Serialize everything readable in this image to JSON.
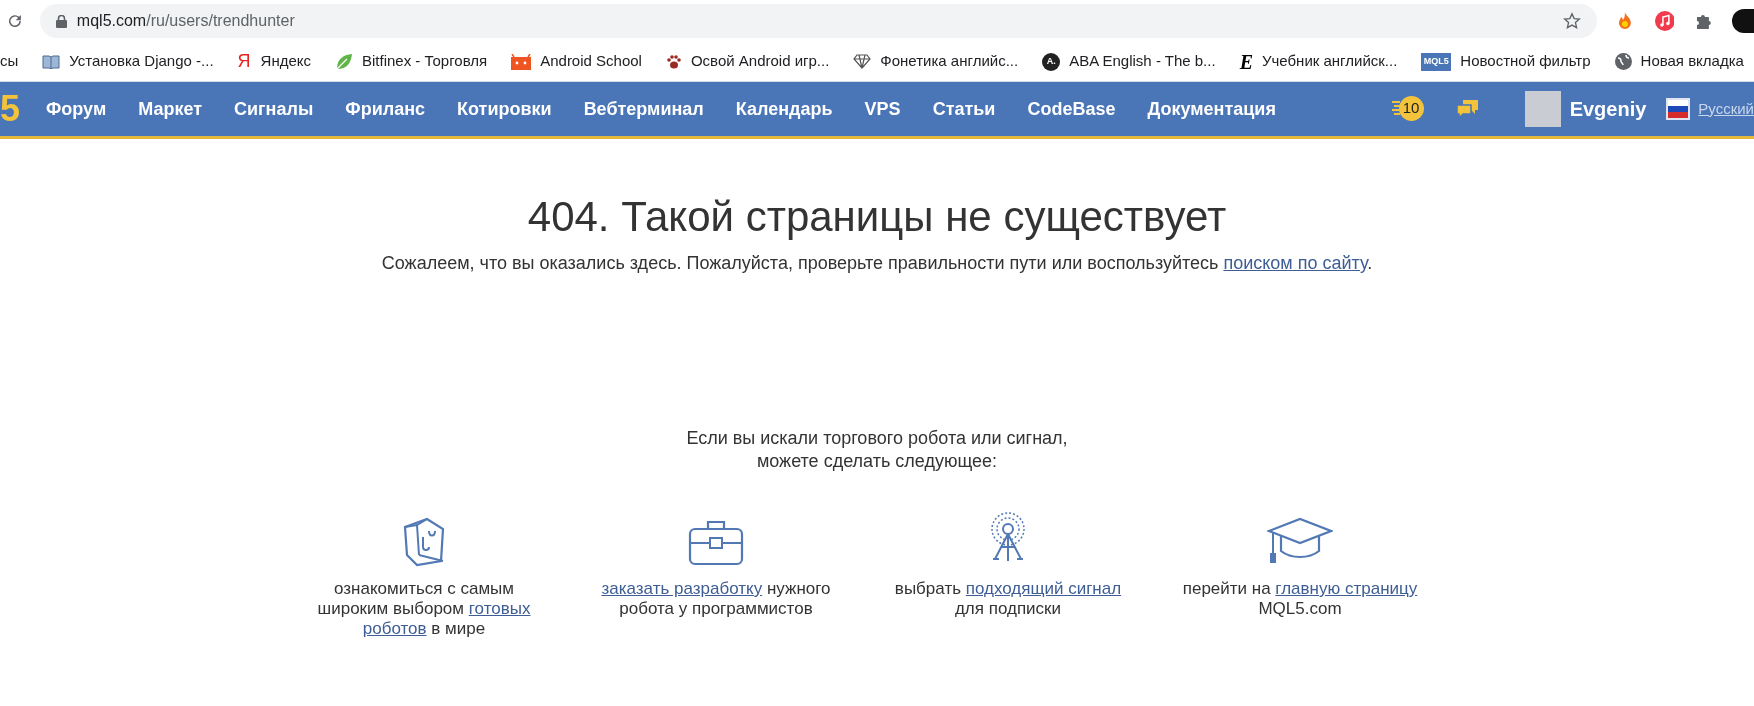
{
  "browser": {
    "url_host": "mql5.com",
    "url_path": "/ru/users/trendhunter"
  },
  "bookmarks": [
    {
      "label": "сы",
      "kind": "none"
    },
    {
      "label": "Установка Django -...",
      "kind": "book"
    },
    {
      "label": "Яндекс",
      "kind": "glyph",
      "glyph": "Я"
    },
    {
      "label": "Bitfinex - Торговля",
      "kind": "leaf"
    },
    {
      "label": "Android School",
      "kind": "android"
    },
    {
      "label": "Освой Android игр...",
      "kind": "paw"
    },
    {
      "label": "Фонетика английс...",
      "kind": "diamond"
    },
    {
      "label": "ABA English - The b...",
      "kind": "circle",
      "glyph": "A."
    },
    {
      "label": "Учебник английск...",
      "kind": "glyph_dark",
      "glyph": "E"
    },
    {
      "label": "Новостной фильтр",
      "kind": "badge",
      "glyph": "MQL5"
    },
    {
      "label": "Новая вкладка",
      "kind": "globe"
    }
  ],
  "site_nav": {
    "logo": "5",
    "items": [
      "Форум",
      "Маркет",
      "Сигналы",
      "Фриланс",
      "Котировки",
      "Вебтерминал",
      "Календарь",
      "VPS",
      "Статьи",
      "CodeBase",
      "Документация"
    ],
    "notifications": "10",
    "user": "Evgeniy",
    "language": "Русский"
  },
  "error": {
    "title": "404. Такой страницы не существует",
    "message": [
      {
        "text": "Сожалеем, что вы оказались здесь. Пожалуйста, проверьте правильности пути или воспользуйтесь ",
        "link": false
      },
      {
        "text": "поиском по сайту",
        "link": true
      },
      {
        "text": ".",
        "link": false
      }
    ]
  },
  "suggestions": {
    "intro": [
      "Если вы искали торгового робота или сигнал,",
      "можете сделать следующее:"
    ],
    "options": [
      {
        "kind": "bag",
        "lines": [
          [
            {
              "text": "ознакомиться с самым",
              "link": false
            }
          ],
          [
            {
              "text": "широким выбором ",
              "link": false
            },
            {
              "text": "готовых",
              "link": true
            }
          ],
          [
            {
              "text": "роботов",
              "link": true
            },
            {
              "text": " в мире",
              "link": false
            }
          ]
        ]
      },
      {
        "kind": "briefcase",
        "lines": [
          [
            {
              "text": "заказать разработку",
              "link": true
            },
            {
              "text": " нужного",
              "link": false
            }
          ],
          [
            {
              "text": "робота у программистов",
              "link": false
            }
          ]
        ]
      },
      {
        "kind": "tower",
        "lines": [
          [
            {
              "text": "выбрать ",
              "link": false
            },
            {
              "text": "подходящий сигнал",
              "link": true
            }
          ],
          [
            {
              "text": "для подписки",
              "link": false
            }
          ]
        ]
      },
      {
        "kind": "cap",
        "lines": [
          [
            {
              "text": "перейти на ",
              "link": false
            },
            {
              "text": "главную страницу",
              "link": true
            }
          ],
          [
            {
              "text": "MQL5.com",
              "link": false
            }
          ]
        ]
      }
    ]
  }
}
